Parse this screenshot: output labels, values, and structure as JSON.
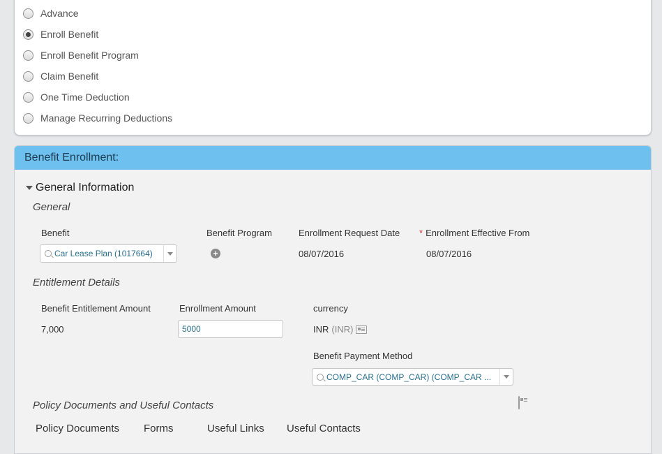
{
  "options": [
    {
      "label": "Advance",
      "checked": false
    },
    {
      "label": "Enroll Benefit",
      "checked": true
    },
    {
      "label": "Enroll Benefit Program",
      "checked": false
    },
    {
      "label": "Claim Benefit",
      "checked": false
    },
    {
      "label": "One Time Deduction",
      "checked": false
    },
    {
      "label": "Manage Recurring Deductions",
      "checked": false
    }
  ],
  "panel": {
    "title": "Benefit Enrollment:",
    "section_title": "General Information",
    "general": {
      "title": "General",
      "benefit_label": "Benefit",
      "benefit_value": "Car Lease Plan (1017664)",
      "program_label": "Benefit Program",
      "request_date_label": "Enrollment Request Date",
      "request_date_value": "08/07/2016",
      "required_mark": "*",
      "effective_from_label": "Enrollment Effective From",
      "effective_from_value": "08/07/2016"
    },
    "entitlement": {
      "title": "Entitlement Details",
      "entitlement_amount_label": "Benefit Entitlement Amount",
      "entitlement_amount_value": "7,000",
      "enrollment_amount_label": "Enrollment Amount",
      "enrollment_amount_value": "5000",
      "currency_label": "currency",
      "currency_code": "INR",
      "currency_detail": "(INR)",
      "payment_method_label": "Benefit Payment Method",
      "payment_method_value": "COMP_CAR (COMP_CAR) (COMP_CAR ..."
    },
    "policy": {
      "title": "Policy Documents and Useful Contacts",
      "tabs": [
        "Policy Documents",
        "Forms",
        "Useful Links",
        "Useful Contacts"
      ]
    }
  }
}
